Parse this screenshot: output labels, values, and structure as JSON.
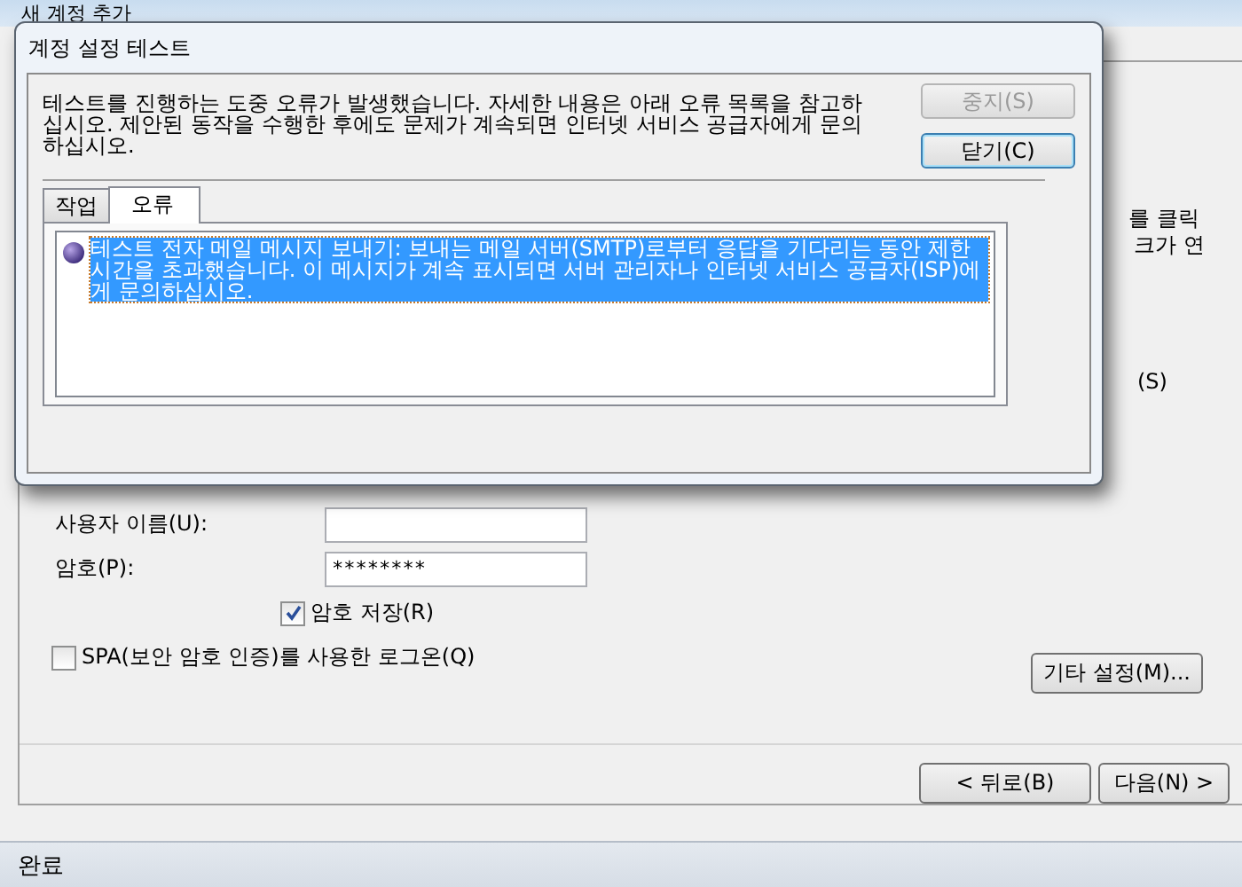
{
  "window": {
    "title": "새 계정 추가"
  },
  "background_fragments": [
    "를 클릭",
    "크가 연",
    "(S)"
  ],
  "form": {
    "fields": [
      {
        "label": "사용자 이름(U):"
      },
      {
        "label": "암호(P):",
        "value": "********"
      }
    ],
    "save_password": {
      "label": "암호 저장(R)",
      "checked": true
    },
    "spa": {
      "label": "SPA(보안 암호 인증)를 사용한 로그온(Q)",
      "checked": false
    },
    "more_settings": "기타 설정(M)..."
  },
  "nav_buttons": [
    "< 뒤로(B)",
    "다음(N) >"
  ],
  "status_bar": {
    "text": "완료"
  },
  "dialog": {
    "title": "계정 설정 테스트",
    "message": "테스트를 진행하는 도중 오류가 발생했습니다. 자세한 내용은 아래 오류 목록을 참고하십시오. 제안된 동작을 수행한 후에도 문제가 계속되면 인터넷 서비스 공급자에게 문의하십시오.",
    "buttons": [
      {
        "label": "중지(S)",
        "disabled": true
      },
      {
        "label": "닫기(C)",
        "disabled": false
      }
    ],
    "tabs": [
      {
        "label": "작업",
        "selected": false
      },
      {
        "label": "오류",
        "selected": true
      }
    ],
    "errors": [
      {
        "text": "테스트 전자 메일 메시지 보내기: 보내는 메일 서버(SMTP)로부터 응답을 기다리는 동안 제한 시간을 초과했습니다. 이 메시지가 계속 표시되면 서버 관리자나 인터넷 서비스 공급자(ISP)에게 문의하십시오.",
        "selected": true
      }
    ]
  }
}
